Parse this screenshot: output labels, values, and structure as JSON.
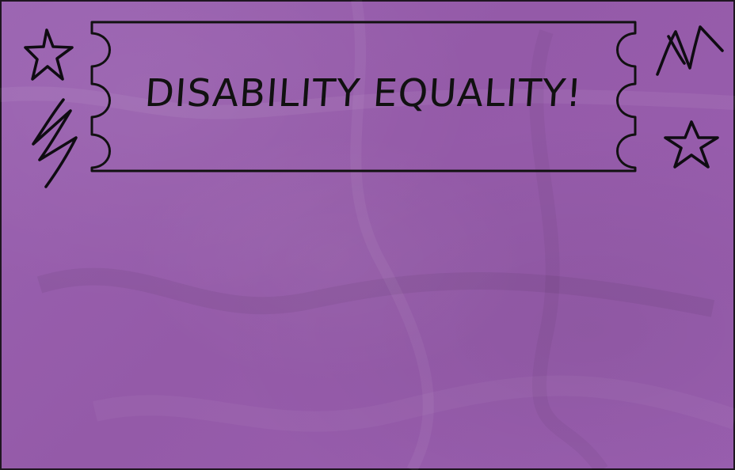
{
  "banner": {
    "title": "DISABILITY EQUALITY!"
  },
  "colors": {
    "background": "#9a5fb0",
    "ink": "#111111"
  },
  "decorations": {
    "icons": [
      "star-icon",
      "zigzag-icon",
      "zigzag-icon",
      "star-icon"
    ]
  }
}
